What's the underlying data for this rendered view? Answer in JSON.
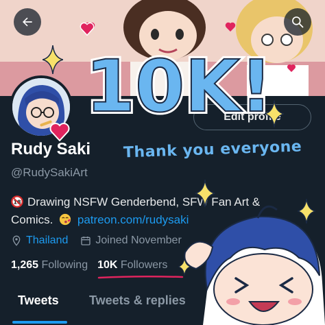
{
  "profile": {
    "name": "Rudy Saki",
    "handle": "@RudySakiArt",
    "edit_label": "Edit profile",
    "bio_line1": "Drawing NSFW Genderbend, SFW Fan Art &",
    "bio_line2_pre": "Comics.",
    "bio_link": "patreon.com/rudysaki",
    "location": "Thailand",
    "joined": "Joined November",
    "following_count": "1,265",
    "following_label": "Following",
    "followers_count": "10K",
    "followers_label": "Followers"
  },
  "tabs": [
    {
      "label": "Tweets"
    },
    {
      "label": "Tweets & replies"
    }
  ],
  "celebration": {
    "big_text": "10K!",
    "message": "Thank you everyone"
  },
  "colors": {
    "accent": "#1d9bf0",
    "background": "#15202b",
    "muted": "#8b98a5",
    "celebration_blue": "#6ab6f0",
    "highlight_red": "#e0245e"
  },
  "icons": {
    "back": "arrow-left-icon",
    "search": "search-icon",
    "age_restriction": "no-under-18-icon",
    "kiss": "kiss-emoji-icon",
    "location": "location-pin-icon",
    "calendar": "calendar-icon"
  }
}
